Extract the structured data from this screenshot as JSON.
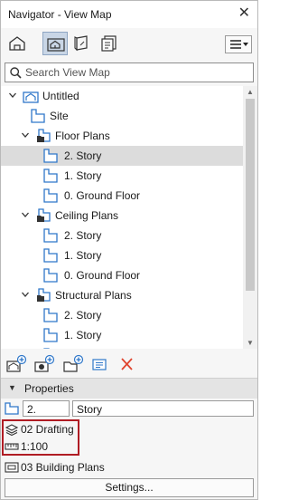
{
  "window": {
    "title": "Navigator - View Map",
    "close_glyph": "✕"
  },
  "toolbar": {
    "buttons": [
      {
        "name": "project-map-icon",
        "active": false
      },
      {
        "name": "view-map-icon",
        "active": true
      },
      {
        "name": "layout-book-icon",
        "active": false
      },
      {
        "name": "publisher-sets-icon",
        "active": false
      }
    ],
    "menu_icon": "hamburger-menu-icon"
  },
  "search": {
    "placeholder": "Search View Map",
    "value": ""
  },
  "tree": {
    "items": [
      {
        "label": "Untitled",
        "level": 0,
        "toggle": "expanded",
        "icon": "project-icon",
        "selected": false
      },
      {
        "label": "Site",
        "level": 1,
        "toggle": "none",
        "icon": "view-icon",
        "selected": false
      },
      {
        "label": "Floor Plans",
        "level": 1,
        "toggle": "expanded",
        "icon": "folder-view-icon",
        "selected": false
      },
      {
        "label": "2. Story",
        "level": 2,
        "toggle": "none",
        "icon": "view-icon",
        "selected": true
      },
      {
        "label": "1. Story",
        "level": 2,
        "toggle": "none",
        "icon": "view-icon",
        "selected": false
      },
      {
        "label": "0. Ground Floor",
        "level": 2,
        "toggle": "none",
        "icon": "view-icon",
        "selected": false
      },
      {
        "label": "Ceiling Plans",
        "level": 1,
        "toggle": "expanded",
        "icon": "folder-view-icon",
        "selected": false
      },
      {
        "label": "2. Story",
        "level": 2,
        "toggle": "none",
        "icon": "view-icon",
        "selected": false
      },
      {
        "label": "1. Story",
        "level": 2,
        "toggle": "none",
        "icon": "view-icon",
        "selected": false
      },
      {
        "label": "0. Ground Floor",
        "level": 2,
        "toggle": "none",
        "icon": "view-icon",
        "selected": false
      },
      {
        "label": "Structural Plans",
        "level": 1,
        "toggle": "expanded",
        "icon": "folder-view-icon",
        "selected": false
      },
      {
        "label": "2. Story",
        "level": 2,
        "toggle": "none",
        "icon": "view-icon",
        "selected": false
      },
      {
        "label": "1. Story",
        "level": 2,
        "toggle": "none",
        "icon": "view-icon",
        "selected": false
      },
      {
        "label": "",
        "level": 2,
        "toggle": "none",
        "icon": "view-icon",
        "selected": false
      }
    ]
  },
  "actions": [
    {
      "name": "save-view-icon"
    },
    {
      "name": "clone-view-icon"
    },
    {
      "name": "new-folder-icon"
    },
    {
      "name": "view-settings-icon"
    },
    {
      "name": "delete-icon"
    }
  ],
  "properties": {
    "header": "Properties",
    "id_value": "2.",
    "name_value": "Story",
    "layer_combination": "02 Drafting",
    "scale": "1:100",
    "model_view_option": "03 Building Plans",
    "settings_label": "Settings..."
  },
  "colors": {
    "selection": "#dcdcdc",
    "icon_blue": "#2f77c9",
    "delete_red": "#e0452f",
    "highlight_border": "#b01c24",
    "active_tool": "#c9d6e6"
  }
}
